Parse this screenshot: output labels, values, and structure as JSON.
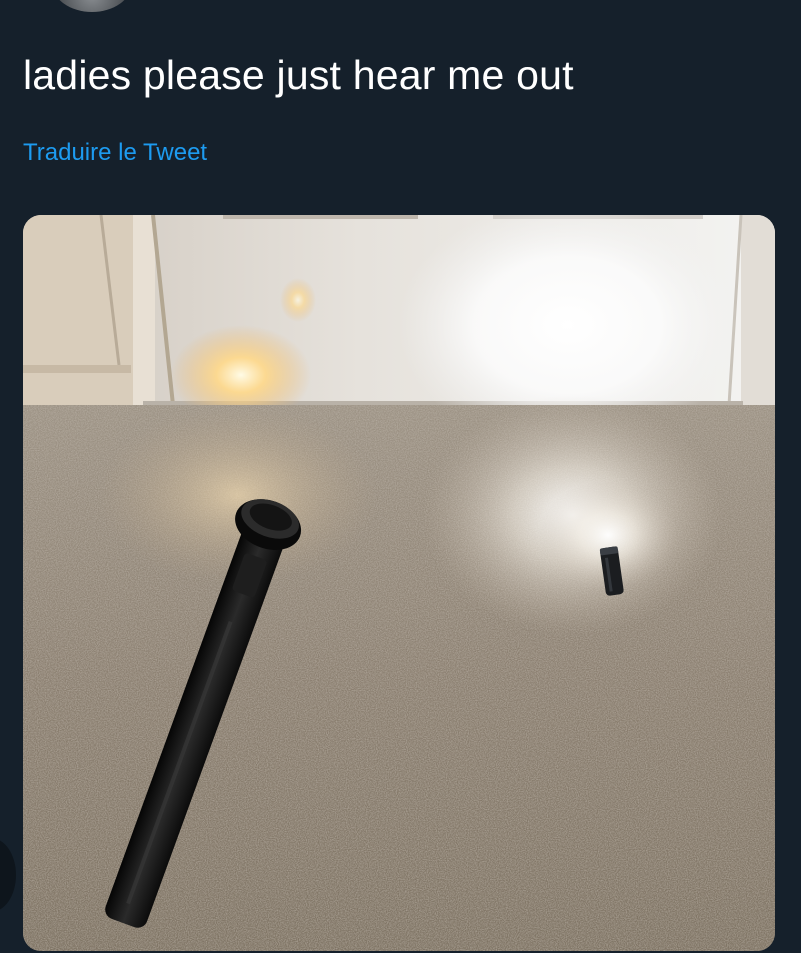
{
  "tweet": {
    "text": "ladies please just hear me out",
    "translate_label": "Traduire le Tweet"
  },
  "media": {
    "description_icon": "flashlight-photo"
  },
  "colors": {
    "background": "#15202b",
    "text": "#ffffff",
    "link": "#1d9bf0"
  }
}
